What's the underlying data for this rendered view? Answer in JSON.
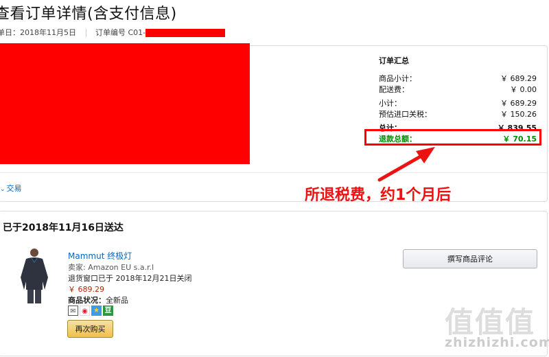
{
  "page": {
    "title": "查看订单详情(含支付信息)",
    "order_date": "单日：2018年11月5日",
    "order_number_label": "订单编号 C01-"
  },
  "details_panel": {
    "transaction_link": "交易"
  },
  "summary": {
    "heading": "订单汇总",
    "rows": [
      {
        "label": "商品小计：",
        "value": "￥ 689.29"
      },
      {
        "label": "配送费：",
        "value": "￥ 0.00"
      },
      {
        "label": "小计：",
        "value": "￥ 689.29"
      },
      {
        "label": "预估进口关税：",
        "value": "￥ 150.26"
      },
      {
        "label": "总计：",
        "value": "￥ 839.55"
      }
    ],
    "refund": {
      "label": "退款总额：",
      "value": "￥ 70.15"
    },
    "refund_color": "#008a00"
  },
  "annotation": {
    "callout_text": "所退税费，约1个月后",
    "color": "#ee1111"
  },
  "shipment": {
    "delivered_heading": "已于2018年11月16日送达",
    "product_title": "Mammut 终极灯",
    "seller": "卖家: Amazon EU s.a.r.l",
    "return_window": "退货窗口已于 2018年12月21日关闭",
    "price": "￥ 689.29",
    "condition_label": "商品状况：",
    "condition_value": "全新品",
    "share_icons": [
      "mail-icon",
      "weibo-icon",
      "qzone-icon",
      "douban-icon"
    ],
    "douban_glyph": "豆",
    "buy_again_label": "再次购买",
    "review_button_label": "撰写商品评论"
  },
  "watermark": {
    "glyphs": "值值值",
    "url": "zhizhizhi.com"
  }
}
